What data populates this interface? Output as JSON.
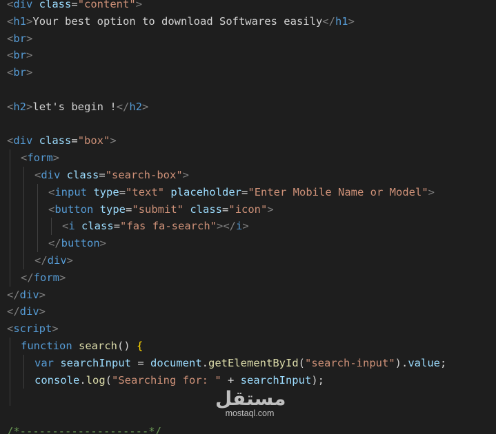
{
  "watermark": {
    "logo": "مستقل",
    "domain": "mostaql.com"
  },
  "lines": [
    {
      "indent": 0,
      "tokens": [
        {
          "t": "<",
          "c": "punct"
        },
        {
          "t": "div",
          "c": "tag"
        },
        {
          "t": " class",
          "c": "attr"
        },
        {
          "t": "=",
          "c": "text"
        },
        {
          "t": "\"content\"",
          "c": "str"
        },
        {
          "t": ">",
          "c": "punct"
        }
      ]
    },
    {
      "indent": 0,
      "tokens": [
        {
          "t": "<",
          "c": "punct"
        },
        {
          "t": "h1",
          "c": "tag"
        },
        {
          "t": ">",
          "c": "punct"
        },
        {
          "t": "Your best option to download Softwares easily",
          "c": "text"
        },
        {
          "t": "</",
          "c": "punct"
        },
        {
          "t": "h1",
          "c": "tag"
        },
        {
          "t": ">",
          "c": "punct"
        }
      ]
    },
    {
      "indent": 0,
      "tokens": [
        {
          "t": "<",
          "c": "punct"
        },
        {
          "t": "br",
          "c": "tag"
        },
        {
          "t": ">",
          "c": "punct"
        }
      ]
    },
    {
      "indent": 0,
      "tokens": [
        {
          "t": "<",
          "c": "punct"
        },
        {
          "t": "br",
          "c": "tag"
        },
        {
          "t": ">",
          "c": "punct"
        }
      ]
    },
    {
      "indent": 0,
      "tokens": [
        {
          "t": "<",
          "c": "punct"
        },
        {
          "t": "br",
          "c": "tag"
        },
        {
          "t": ">",
          "c": "punct"
        }
      ]
    },
    {
      "indent": 0,
      "tokens": []
    },
    {
      "indent": 0,
      "tokens": [
        {
          "t": "<",
          "c": "punct"
        },
        {
          "t": "h2",
          "c": "tag"
        },
        {
          "t": ">",
          "c": "punct"
        },
        {
          "t": "let's begin !",
          "c": "text"
        },
        {
          "t": "</",
          "c": "punct"
        },
        {
          "t": "h2",
          "c": "tag"
        },
        {
          "t": ">",
          "c": "punct"
        }
      ]
    },
    {
      "indent": 0,
      "tokens": []
    },
    {
      "indent": 0,
      "tokens": [
        {
          "t": "<",
          "c": "punct"
        },
        {
          "t": "div",
          "c": "tag"
        },
        {
          "t": " class",
          "c": "attr"
        },
        {
          "t": "=",
          "c": "text"
        },
        {
          "t": "\"box\"",
          "c": "str"
        },
        {
          "t": ">",
          "c": "punct"
        }
      ]
    },
    {
      "indent": 1,
      "tokens": [
        {
          "t": "<",
          "c": "punct"
        },
        {
          "t": "form",
          "c": "tag"
        },
        {
          "t": ">",
          "c": "punct"
        }
      ]
    },
    {
      "indent": 2,
      "tokens": [
        {
          "t": "<",
          "c": "punct"
        },
        {
          "t": "div",
          "c": "tag"
        },
        {
          "t": " class",
          "c": "attr"
        },
        {
          "t": "=",
          "c": "text"
        },
        {
          "t": "\"search-box\"",
          "c": "str"
        },
        {
          "t": ">",
          "c": "punct"
        }
      ]
    },
    {
      "indent": 3,
      "tokens": [
        {
          "t": "<",
          "c": "punct"
        },
        {
          "t": "input",
          "c": "tag"
        },
        {
          "t": " type",
          "c": "attr"
        },
        {
          "t": "=",
          "c": "text"
        },
        {
          "t": "\"text\"",
          "c": "str"
        },
        {
          "t": " placeholder",
          "c": "attr"
        },
        {
          "t": "=",
          "c": "text"
        },
        {
          "t": "\"Enter Mobile Name or Model\"",
          "c": "str"
        },
        {
          "t": ">",
          "c": "punct"
        }
      ]
    },
    {
      "indent": 3,
      "tokens": [
        {
          "t": "<",
          "c": "punct"
        },
        {
          "t": "button",
          "c": "tag"
        },
        {
          "t": " type",
          "c": "attr"
        },
        {
          "t": "=",
          "c": "text"
        },
        {
          "t": "\"submit\"",
          "c": "str"
        },
        {
          "t": " class",
          "c": "attr"
        },
        {
          "t": "=",
          "c": "text"
        },
        {
          "t": "\"icon\"",
          "c": "str"
        },
        {
          "t": ">",
          "c": "punct"
        }
      ]
    },
    {
      "indent": 4,
      "tokens": [
        {
          "t": "<",
          "c": "punct"
        },
        {
          "t": "i",
          "c": "tag"
        },
        {
          "t": " class",
          "c": "attr"
        },
        {
          "t": "=",
          "c": "text"
        },
        {
          "t": "\"fas fa-search\"",
          "c": "str"
        },
        {
          "t": "></",
          "c": "punct"
        },
        {
          "t": "i",
          "c": "tag"
        },
        {
          "t": ">",
          "c": "punct"
        }
      ]
    },
    {
      "indent": 3,
      "tokens": [
        {
          "t": "</",
          "c": "punct"
        },
        {
          "t": "button",
          "c": "tag"
        },
        {
          "t": ">",
          "c": "punct"
        }
      ]
    },
    {
      "indent": 2,
      "tokens": [
        {
          "t": "</",
          "c": "punct"
        },
        {
          "t": "div",
          "c": "tag"
        },
        {
          "t": ">",
          "c": "punct"
        }
      ]
    },
    {
      "indent": 1,
      "tokens": [
        {
          "t": "</",
          "c": "punct"
        },
        {
          "t": "form",
          "c": "tag"
        },
        {
          "t": ">",
          "c": "punct"
        }
      ]
    },
    {
      "indent": 0,
      "tokens": [
        {
          "t": "</",
          "c": "punct"
        },
        {
          "t": "div",
          "c": "tag"
        },
        {
          "t": ">",
          "c": "punct"
        }
      ]
    },
    {
      "indent": 0,
      "tokens": [
        {
          "t": "</",
          "c": "punct"
        },
        {
          "t": "div",
          "c": "tag"
        },
        {
          "t": ">",
          "c": "punct"
        }
      ]
    },
    {
      "indent": 0,
      "tokens": [
        {
          "t": "<",
          "c": "punct"
        },
        {
          "t": "script",
          "c": "tag"
        },
        {
          "t": ">",
          "c": "punct"
        }
      ]
    },
    {
      "indent": 1,
      "tokens": [
        {
          "t": "function",
          "c": "kw"
        },
        {
          "t": " ",
          "c": "text"
        },
        {
          "t": "search",
          "c": "fn"
        },
        {
          "t": "() ",
          "c": "text"
        },
        {
          "t": "{",
          "c": "brace"
        }
      ]
    },
    {
      "indent": 2,
      "tokens": [
        {
          "t": "var",
          "c": "kw"
        },
        {
          "t": " ",
          "c": "text"
        },
        {
          "t": "searchInput",
          "c": "var"
        },
        {
          "t": " = ",
          "c": "text"
        },
        {
          "t": "document",
          "c": "var"
        },
        {
          "t": ".",
          "c": "text"
        },
        {
          "t": "getElementById",
          "c": "fn"
        },
        {
          "t": "(",
          "c": "text"
        },
        {
          "t": "\"search-input\"",
          "c": "str"
        },
        {
          "t": ").",
          "c": "text"
        },
        {
          "t": "value",
          "c": "var"
        },
        {
          "t": ";",
          "c": "text"
        }
      ]
    },
    {
      "indent": 2,
      "tokens": [
        {
          "t": "console",
          "c": "var"
        },
        {
          "t": ".",
          "c": "text"
        },
        {
          "t": "log",
          "c": "fn"
        },
        {
          "t": "(",
          "c": "text"
        },
        {
          "t": "\"Searching for: \"",
          "c": "str"
        },
        {
          "t": " + ",
          "c": "text"
        },
        {
          "t": "searchInput",
          "c": "var"
        },
        {
          "t": ");",
          "c": "text"
        }
      ]
    },
    {
      "indent": 1,
      "tokens": []
    },
    {
      "indent": 0,
      "tokens": []
    },
    {
      "indent": 0,
      "tokens": [
        {
          "t": "/*--------------------*/",
          "c": "comment"
        }
      ]
    }
  ]
}
